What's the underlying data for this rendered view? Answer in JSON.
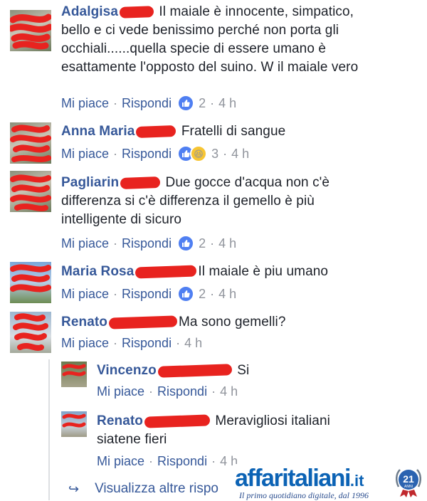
{
  "comments": [
    {
      "name": "Adalgisa",
      "text_lines": [
        "Il maiale è innocente, simpatico,",
        "bello e ci vede benissimo perché non porta gli",
        "occhiali......quella specie di essere umano è",
        "esattamente l'opposto del suino. W il maiale vero"
      ],
      "like": "Mi piace",
      "reply": "Rispondi",
      "reaction_count": "2",
      "time": "4 h"
    },
    {
      "name": "Anna Maria",
      "text_lines": [
        "Fratelli di sangue"
      ],
      "like": "Mi piace",
      "reply": "Rispondi",
      "reaction_count": "3",
      "time": "4 h"
    },
    {
      "name": "Pagliarin",
      "text_lines": [
        "Due gocce d'acqua non c'è",
        "differenza si c'è differenza il gemello è più",
        "intelligente di sicuro"
      ],
      "like": "Mi piace",
      "reply": "Rispondi",
      "reaction_count": "2",
      "time": "4 h"
    },
    {
      "name": "Maria Rosa",
      "text_lines": [
        "Il maiale è piu umano"
      ],
      "like": "Mi piace",
      "reply": "Rispondi",
      "reaction_count": "2",
      "time": "4 h"
    },
    {
      "name": "Renato",
      "text_lines": [
        "Ma sono gemelli?"
      ],
      "like": "Mi piace",
      "reply": "Rispondi",
      "time": "4 h"
    }
  ],
  "replies": [
    {
      "name": "Vincenzo",
      "text_lines": [
        "Si"
      ],
      "like": "Mi piace",
      "reply": "Rispondi",
      "time": "4 h"
    },
    {
      "name": "Renato",
      "text_lines": [
        "Meravigliosi italiani",
        "siatene fieri"
      ],
      "like": "Mi piace",
      "reply": "Rispondi",
      "time": "4 h"
    }
  ],
  "more_replies": "Visualizza altre rispo",
  "watermark": {
    "brand_main": "affaritaliani",
    "brand_suffix": ".it",
    "tagline": "Il primo quotidiano digitale, dal 1996",
    "badge_number": "21",
    "badge_text": "ANNI"
  },
  "colors": {
    "name_link": "#365899",
    "meta_gray": "#90949c",
    "redaction": "#e8231f",
    "like_blue": "#4f7ff2"
  }
}
